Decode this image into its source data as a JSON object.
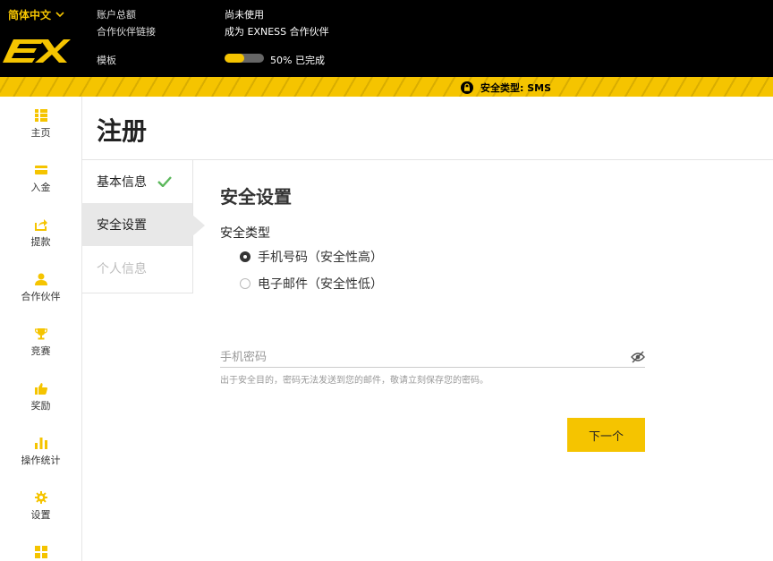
{
  "header": {
    "language": "简体中文",
    "account_balance_label": "账户总额",
    "account_balance_value": "尚未使用",
    "partner_link_label": "合作伙伴链接",
    "partner_link_value": "成为 EXNESS 合作伙伴",
    "template_label": "模板",
    "progress_percent": 50,
    "progress_text": "50% 已完成",
    "security_type": "安全类型: SMS"
  },
  "colors": {
    "accent": "#f5c400",
    "header_bg": "#000000",
    "check": "#5cb85c"
  },
  "sidebar": {
    "items": [
      {
        "label": "主页",
        "icon": "home-grid-icon"
      },
      {
        "label": "入金",
        "icon": "card-icon"
      },
      {
        "label": "提款",
        "icon": "share-out-icon"
      },
      {
        "label": "合作伙伴",
        "icon": "person-icon"
      },
      {
        "label": "竞赛",
        "icon": "trophy-icon"
      },
      {
        "label": "奖励",
        "icon": "thumbs-up-icon"
      },
      {
        "label": "操作统计",
        "icon": "bar-chart-icon"
      },
      {
        "label": "设置",
        "icon": "gear-icon"
      },
      {
        "label": "",
        "icon": "apps-grid-icon"
      }
    ]
  },
  "page": {
    "title": "注册"
  },
  "steps": [
    {
      "label": "基本信息",
      "state": "done"
    },
    {
      "label": "安全设置",
      "state": "active"
    },
    {
      "label": "个人信息",
      "state": "disabled"
    }
  ],
  "form": {
    "section_title": "安全设置",
    "security_type_label": "安全类型",
    "options": [
      {
        "label": "手机号码（安全性高）",
        "checked": true
      },
      {
        "label": "电子邮件（安全性低）",
        "checked": false
      }
    ],
    "password_placeholder": "手机密码",
    "password_value": "",
    "hint": "出于安全目的，密码无法发送到您的邮件，敬请立刻保存您的密码。",
    "next_label": "下一个"
  }
}
